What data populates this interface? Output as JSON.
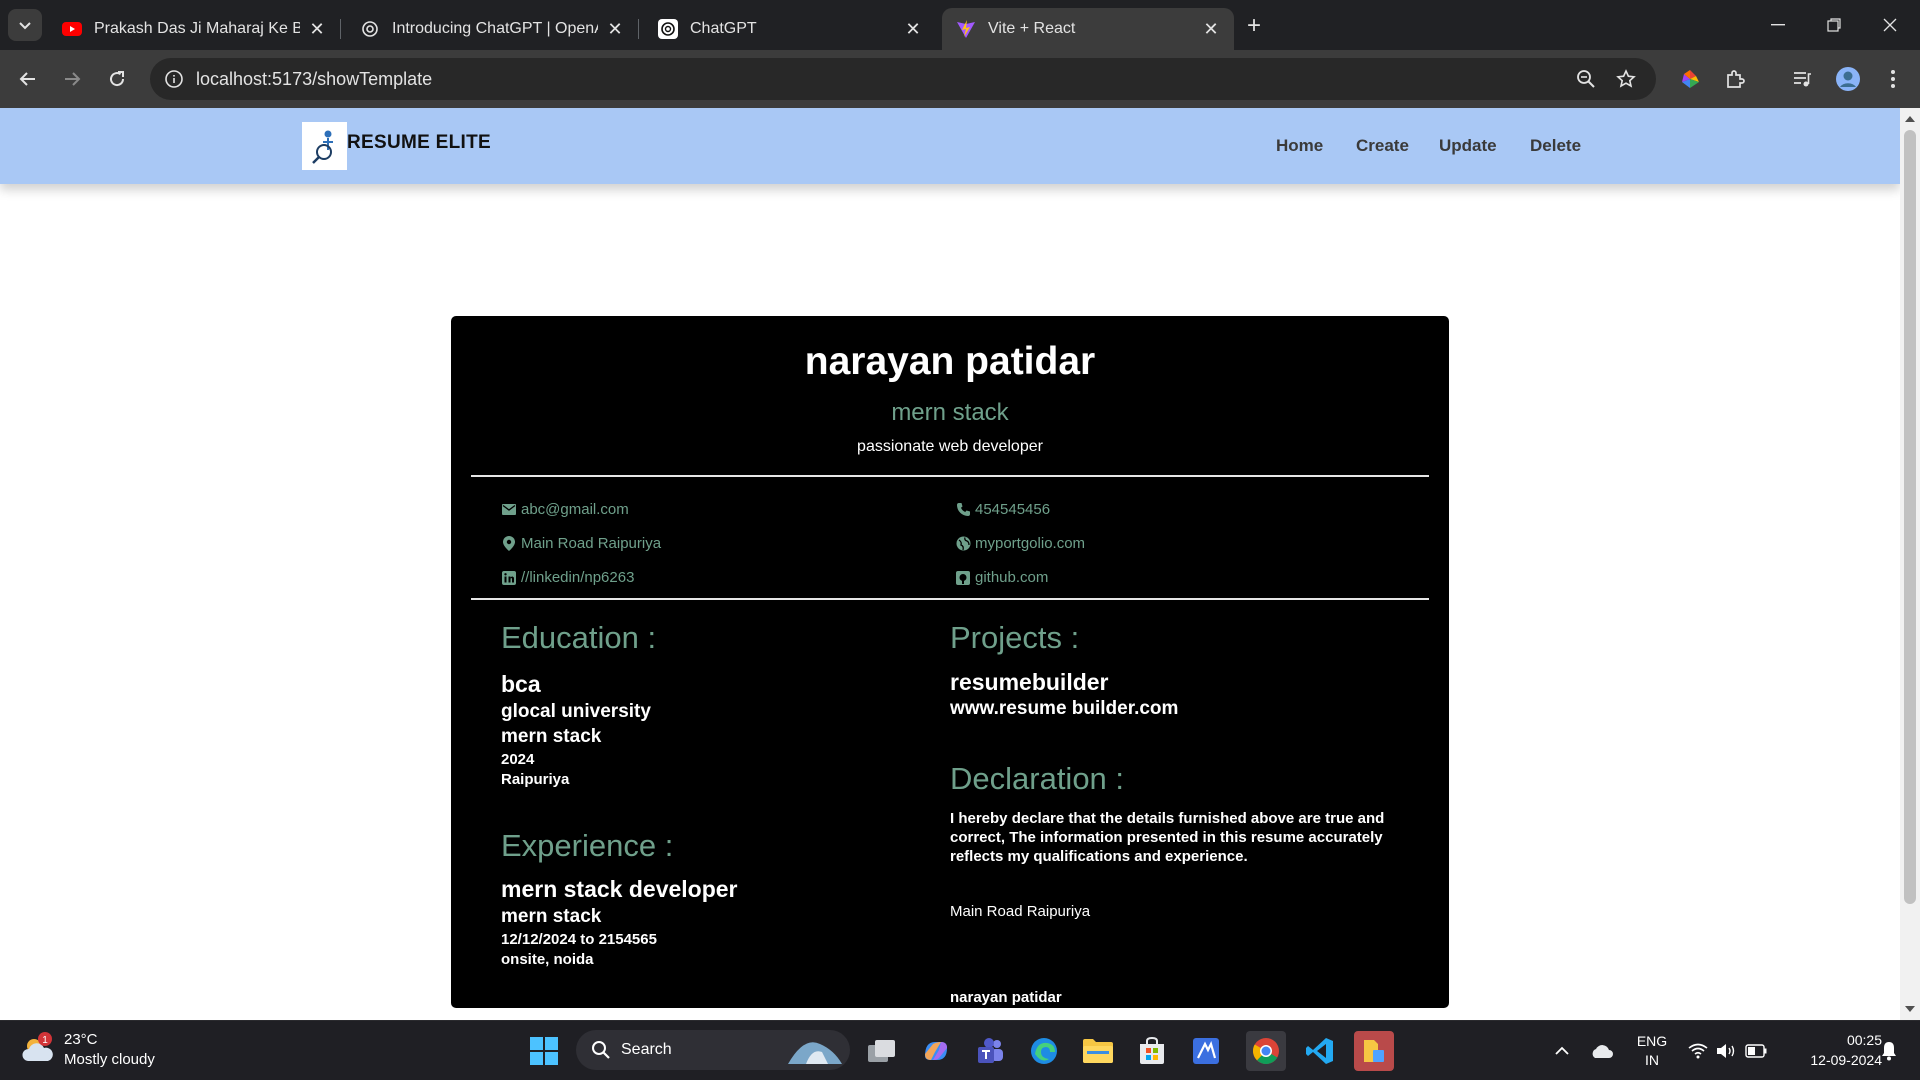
{
  "browser": {
    "tabs": [
      {
        "title": "Prakash Das Ji Maharaj Ke Bhajan",
        "icon": "youtube-icon"
      },
      {
        "title": "Introducing ChatGPT | OpenAI",
        "icon": "openai-icon"
      },
      {
        "title": "ChatGPT",
        "icon": "chatgpt-icon"
      },
      {
        "title": "Vite + React",
        "icon": "vite-icon",
        "active": true
      }
    ],
    "url": "localhost:5173/showTemplate"
  },
  "site": {
    "brand": "RESUME ELITE",
    "nav": [
      "Home",
      "Create",
      "Update",
      "Delete"
    ]
  },
  "resume": {
    "name": "narayan patidar",
    "role": "mern stack",
    "tagline": "passionate web developer",
    "contacts": {
      "email": "abc@gmail.com",
      "phone": "454545456",
      "address": "Main Road Raipuriya",
      "portfolio": "myportgolio.com",
      "linkedin": "//linkedin/np6263",
      "github": "github.com"
    },
    "education": {
      "heading": "Education :",
      "degree": "bca",
      "institute": "glocal university",
      "field": "mern stack",
      "year": "2024",
      "location": "Raipuriya"
    },
    "experience": {
      "heading": "Experience :",
      "title": "mern stack developer",
      "field": "mern stack",
      "duration": "12/12/2024 to 2154565",
      "location": "onsite, noida"
    },
    "projects": {
      "heading": "Projects :",
      "name": "resumebuilder",
      "link": "www.resume builder.com"
    },
    "declaration": {
      "heading": "Declaration :",
      "text": "I hereby declare that the details furnished above are true and correct, The information presented in this resume accurately reflects my qualifications and experience.",
      "name": "narayan patidar",
      "address": "Main Road Raipuriya"
    }
  },
  "taskbar": {
    "weather_temp": "23°C",
    "weather_desc": "Mostly cloudy",
    "weather_badge": "1",
    "search_label": "Search",
    "lang_1": "ENG",
    "lang_2": "IN",
    "time": "00:25",
    "date": "12-09-2024"
  },
  "colors": {
    "navbar": "#a9c8f5",
    "resume_bg": "#000000",
    "accent_green": "#6fa08b"
  }
}
